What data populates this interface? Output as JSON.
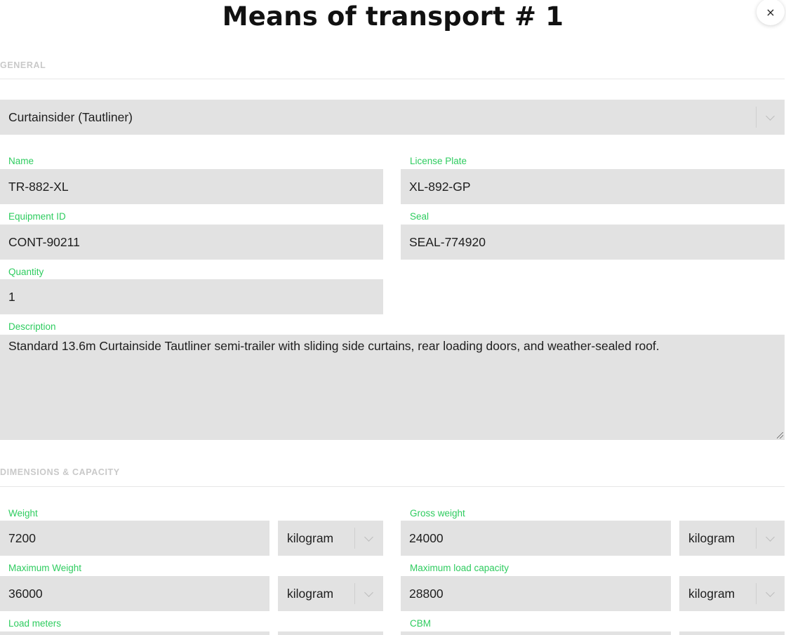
{
  "dialog": {
    "title": "Means of transport # 1",
    "close_label": "×"
  },
  "general": {
    "section_title": "GENERAL",
    "transport_type": "Curtainsider (Tautliner)",
    "name": {
      "label": "Name",
      "value": "TR-882-XL"
    },
    "license_plate": {
      "label": "License Plate",
      "value": "XL-892-GP"
    },
    "equipment_id": {
      "label": "Equipment ID",
      "value": "CONT-90211"
    },
    "seal": {
      "label": "Seal",
      "value": "SEAL-774920"
    },
    "quantity": {
      "label": "Quantity",
      "value": "1"
    },
    "description": {
      "label": "Description",
      "value": "Standard 13.6m Curtainside Tautliner semi-trailer with sliding side curtains, rear loading doors, and weather-sealed roof."
    }
  },
  "dimensions": {
    "section_title": "DIMENSIONS & CAPACITY",
    "weight": {
      "label": "Weight",
      "value": "7200",
      "unit": "kilogram"
    },
    "gross_weight": {
      "label": "Gross weight",
      "value": "24000",
      "unit": "kilogram"
    },
    "maximum_weight": {
      "label": "Maximum Weight",
      "value": "36000",
      "unit": "kilogram"
    },
    "maximum_load_capacity": {
      "label": "Maximum load capacity",
      "value": "28800",
      "unit": "kilogram"
    },
    "load_meters": {
      "label": "Load meters"
    },
    "cbm": {
      "label": "CBM"
    }
  },
  "colors": {
    "label_green": "#2ecc5f",
    "field_bg": "#e2e2e2",
    "section_gray": "#c9c9c9"
  }
}
